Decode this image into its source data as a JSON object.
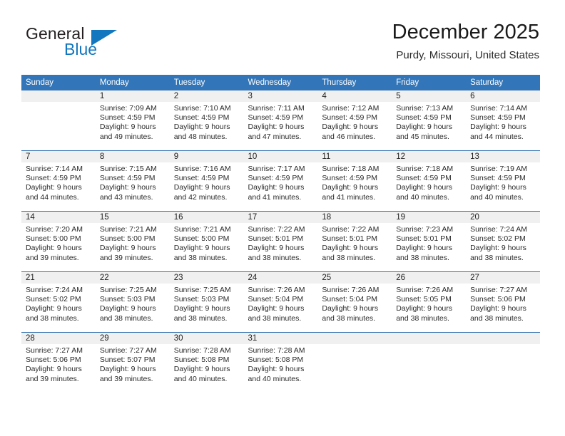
{
  "brand": {
    "name_part1": "General",
    "name_part2": "Blue",
    "triangle_color": "#1277be",
    "text_color": "#231f20"
  },
  "header": {
    "title": "December 2025",
    "location": "Purdy, Missouri, United States"
  },
  "theme": {
    "header_bg": "#3275b8",
    "header_text": "#ffffff",
    "daynum_bg": "#f0f0f0",
    "row_divider": "#2f6fae",
    "body_text": "#2a2a2a"
  },
  "weekday_headers": [
    "Sunday",
    "Monday",
    "Tuesday",
    "Wednesday",
    "Thursday",
    "Friday",
    "Saturday"
  ],
  "labels": {
    "sunrise_prefix": "Sunrise:",
    "sunset_prefix": "Sunset:",
    "daylight_prefix": "Daylight:"
  },
  "weeks": [
    [
      {
        "day": "",
        "line1": "",
        "line2": "",
        "line3": "",
        "line4": ""
      },
      {
        "day": "1",
        "line1": "Sunrise: 7:09 AM",
        "line2": "Sunset: 4:59 PM",
        "line3": "Daylight: 9 hours",
        "line4": "and 49 minutes."
      },
      {
        "day": "2",
        "line1": "Sunrise: 7:10 AM",
        "line2": "Sunset: 4:59 PM",
        "line3": "Daylight: 9 hours",
        "line4": "and 48 minutes."
      },
      {
        "day": "3",
        "line1": "Sunrise: 7:11 AM",
        "line2": "Sunset: 4:59 PM",
        "line3": "Daylight: 9 hours",
        "line4": "and 47 minutes."
      },
      {
        "day": "4",
        "line1": "Sunrise: 7:12 AM",
        "line2": "Sunset: 4:59 PM",
        "line3": "Daylight: 9 hours",
        "line4": "and 46 minutes."
      },
      {
        "day": "5",
        "line1": "Sunrise: 7:13 AM",
        "line2": "Sunset: 4:59 PM",
        "line3": "Daylight: 9 hours",
        "line4": "and 45 minutes."
      },
      {
        "day": "6",
        "line1": "Sunrise: 7:14 AM",
        "line2": "Sunset: 4:59 PM",
        "line3": "Daylight: 9 hours",
        "line4": "and 44 minutes."
      }
    ],
    [
      {
        "day": "7",
        "line1": "Sunrise: 7:14 AM",
        "line2": "Sunset: 4:59 PM",
        "line3": "Daylight: 9 hours",
        "line4": "and 44 minutes."
      },
      {
        "day": "8",
        "line1": "Sunrise: 7:15 AM",
        "line2": "Sunset: 4:59 PM",
        "line3": "Daylight: 9 hours",
        "line4": "and 43 minutes."
      },
      {
        "day": "9",
        "line1": "Sunrise: 7:16 AM",
        "line2": "Sunset: 4:59 PM",
        "line3": "Daylight: 9 hours",
        "line4": "and 42 minutes."
      },
      {
        "day": "10",
        "line1": "Sunrise: 7:17 AM",
        "line2": "Sunset: 4:59 PM",
        "line3": "Daylight: 9 hours",
        "line4": "and 41 minutes."
      },
      {
        "day": "11",
        "line1": "Sunrise: 7:18 AM",
        "line2": "Sunset: 4:59 PM",
        "line3": "Daylight: 9 hours",
        "line4": "and 41 minutes."
      },
      {
        "day": "12",
        "line1": "Sunrise: 7:18 AM",
        "line2": "Sunset: 4:59 PM",
        "line3": "Daylight: 9 hours",
        "line4": "and 40 minutes."
      },
      {
        "day": "13",
        "line1": "Sunrise: 7:19 AM",
        "line2": "Sunset: 4:59 PM",
        "line3": "Daylight: 9 hours",
        "line4": "and 40 minutes."
      }
    ],
    [
      {
        "day": "14",
        "line1": "Sunrise: 7:20 AM",
        "line2": "Sunset: 5:00 PM",
        "line3": "Daylight: 9 hours",
        "line4": "and 39 minutes."
      },
      {
        "day": "15",
        "line1": "Sunrise: 7:21 AM",
        "line2": "Sunset: 5:00 PM",
        "line3": "Daylight: 9 hours",
        "line4": "and 39 minutes."
      },
      {
        "day": "16",
        "line1": "Sunrise: 7:21 AM",
        "line2": "Sunset: 5:00 PM",
        "line3": "Daylight: 9 hours",
        "line4": "and 38 minutes."
      },
      {
        "day": "17",
        "line1": "Sunrise: 7:22 AM",
        "line2": "Sunset: 5:01 PM",
        "line3": "Daylight: 9 hours",
        "line4": "and 38 minutes."
      },
      {
        "day": "18",
        "line1": "Sunrise: 7:22 AM",
        "line2": "Sunset: 5:01 PM",
        "line3": "Daylight: 9 hours",
        "line4": "and 38 minutes."
      },
      {
        "day": "19",
        "line1": "Sunrise: 7:23 AM",
        "line2": "Sunset: 5:01 PM",
        "line3": "Daylight: 9 hours",
        "line4": "and 38 minutes."
      },
      {
        "day": "20",
        "line1": "Sunrise: 7:24 AM",
        "line2": "Sunset: 5:02 PM",
        "line3": "Daylight: 9 hours",
        "line4": "and 38 minutes."
      }
    ],
    [
      {
        "day": "21",
        "line1": "Sunrise: 7:24 AM",
        "line2": "Sunset: 5:02 PM",
        "line3": "Daylight: 9 hours",
        "line4": "and 38 minutes."
      },
      {
        "day": "22",
        "line1": "Sunrise: 7:25 AM",
        "line2": "Sunset: 5:03 PM",
        "line3": "Daylight: 9 hours",
        "line4": "and 38 minutes."
      },
      {
        "day": "23",
        "line1": "Sunrise: 7:25 AM",
        "line2": "Sunset: 5:03 PM",
        "line3": "Daylight: 9 hours",
        "line4": "and 38 minutes."
      },
      {
        "day": "24",
        "line1": "Sunrise: 7:26 AM",
        "line2": "Sunset: 5:04 PM",
        "line3": "Daylight: 9 hours",
        "line4": "and 38 minutes."
      },
      {
        "day": "25",
        "line1": "Sunrise: 7:26 AM",
        "line2": "Sunset: 5:04 PM",
        "line3": "Daylight: 9 hours",
        "line4": "and 38 minutes."
      },
      {
        "day": "26",
        "line1": "Sunrise: 7:26 AM",
        "line2": "Sunset: 5:05 PM",
        "line3": "Daylight: 9 hours",
        "line4": "and 38 minutes."
      },
      {
        "day": "27",
        "line1": "Sunrise: 7:27 AM",
        "line2": "Sunset: 5:06 PM",
        "line3": "Daylight: 9 hours",
        "line4": "and 38 minutes."
      }
    ],
    [
      {
        "day": "28",
        "line1": "Sunrise: 7:27 AM",
        "line2": "Sunset: 5:06 PM",
        "line3": "Daylight: 9 hours",
        "line4": "and 39 minutes."
      },
      {
        "day": "29",
        "line1": "Sunrise: 7:27 AM",
        "line2": "Sunset: 5:07 PM",
        "line3": "Daylight: 9 hours",
        "line4": "and 39 minutes."
      },
      {
        "day": "30",
        "line1": "Sunrise: 7:28 AM",
        "line2": "Sunset: 5:08 PM",
        "line3": "Daylight: 9 hours",
        "line4": "and 40 minutes."
      },
      {
        "day": "31",
        "line1": "Sunrise: 7:28 AM",
        "line2": "Sunset: 5:08 PM",
        "line3": "Daylight: 9 hours",
        "line4": "and 40 minutes."
      },
      {
        "day": "",
        "line1": "",
        "line2": "",
        "line3": "",
        "line4": ""
      },
      {
        "day": "",
        "line1": "",
        "line2": "",
        "line3": "",
        "line4": ""
      },
      {
        "day": "",
        "line1": "",
        "line2": "",
        "line3": "",
        "line4": ""
      }
    ]
  ]
}
